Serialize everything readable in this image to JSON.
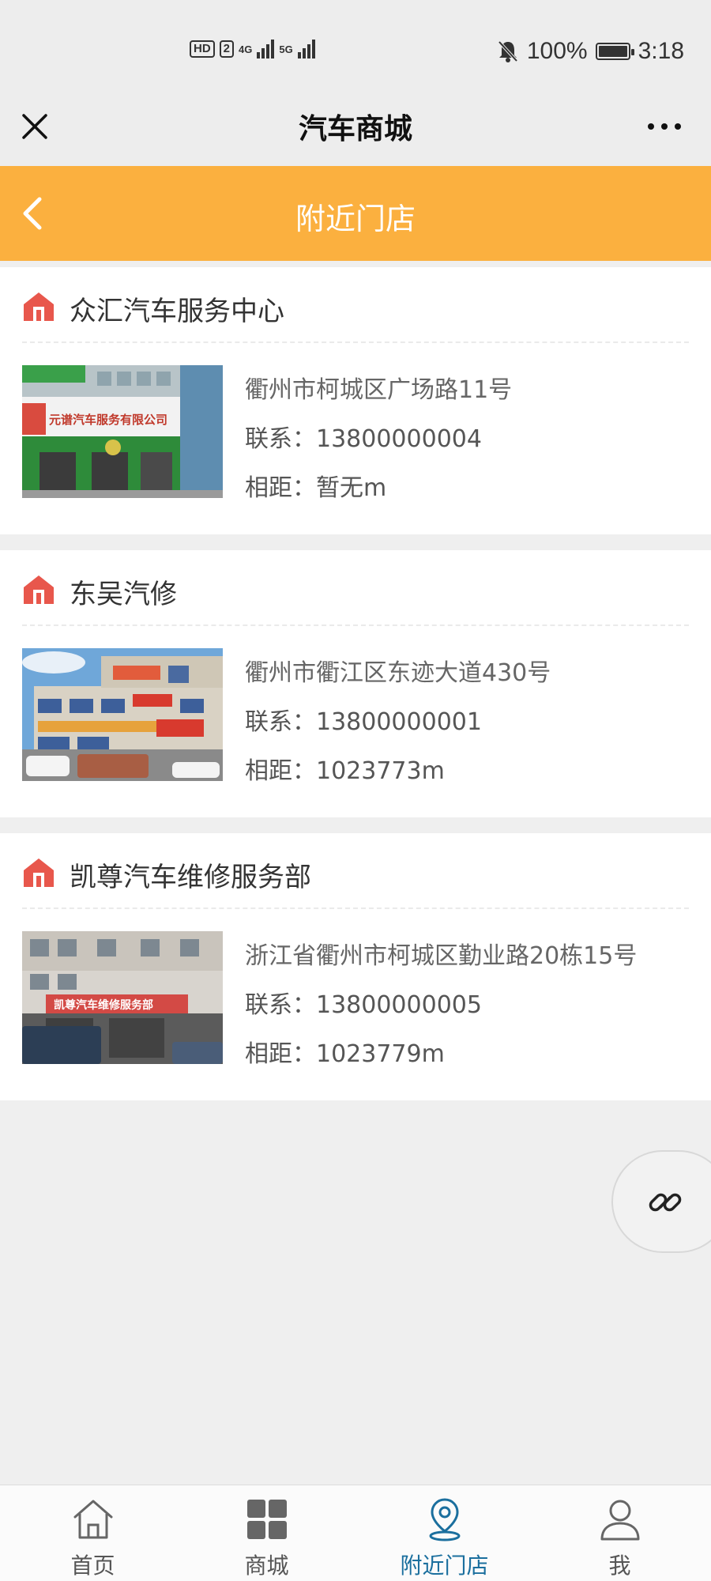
{
  "status_bar": {
    "hd": "HD",
    "sim": "2",
    "net1": "4G",
    "net2": "5G",
    "battery": "100%",
    "time": "3:18"
  },
  "title_bar": {
    "title": "汽车商城",
    "close_icon": "close-icon",
    "more_icon": "more-icon"
  },
  "header": {
    "title": "附近门店",
    "back_icon": "chevron-left-icon",
    "color": "#fbb03f"
  },
  "stores": [
    {
      "name": "众汇汽车服务中心",
      "address": "衢州市柯城区广场路11号",
      "phone": "联系：13800000004",
      "distance": "相距：暂无m"
    },
    {
      "name": "东吴汽修",
      "address": "衢州市衢江区东迹大道430号",
      "phone": "联系：13800000001",
      "distance": "相距：1023773m"
    },
    {
      "name": "凯尊汽车维修服务部",
      "address": "浙江省衢州市柯城区勤业路20栋15号",
      "phone": "联系：13800000005",
      "distance": "相距：1023779m"
    }
  ],
  "photo_signs": {
    "store1": "元谱汽车服务有限公司",
    "store3": "凯尊汽车维修服务部"
  },
  "floating": {
    "icon": "link-icon"
  },
  "tabs": [
    {
      "label": "首页",
      "icon": "home-icon",
      "active": false
    },
    {
      "label": "商城",
      "icon": "grid-icon",
      "active": false
    },
    {
      "label": "附近门店",
      "icon": "location-icon",
      "active": true
    },
    {
      "label": "我",
      "icon": "user-icon",
      "active": false
    }
  ],
  "accent_colors": {
    "store_icon": "#e8574c",
    "active_tab": "#1b6f9e"
  }
}
